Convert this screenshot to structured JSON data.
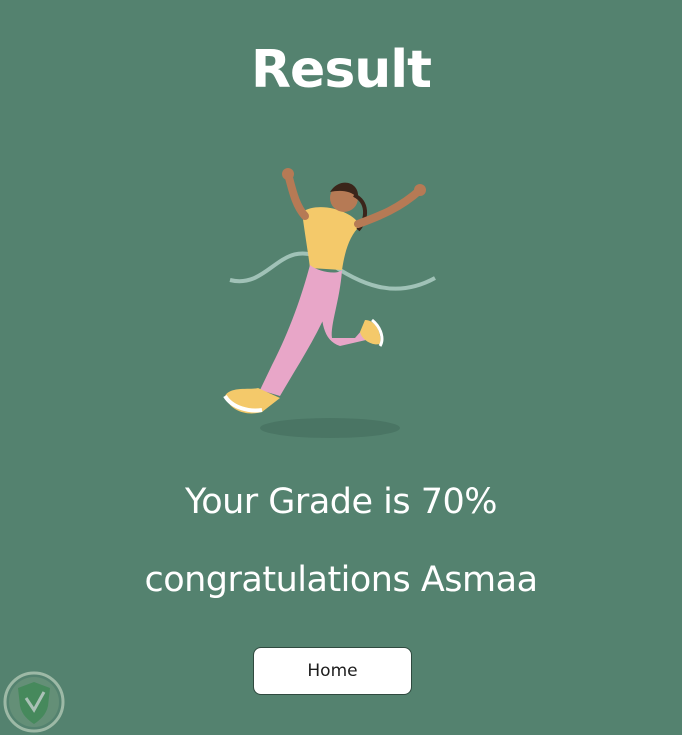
{
  "page": {
    "title": "Result"
  },
  "result": {
    "grade_text": "Your Grade is 70%",
    "congrats_text": "congratulations Asmaa"
  },
  "actions": {
    "home_label": "Home"
  },
  "colors": {
    "background": "#54826f",
    "text": "#ffffff",
    "button_bg": "#ffffff",
    "shirt": "#f4c96a",
    "pants": "#e8a6c8"
  },
  "icons": {
    "hero": "runner-illustration",
    "watermark": "shield-badge-icon"
  }
}
